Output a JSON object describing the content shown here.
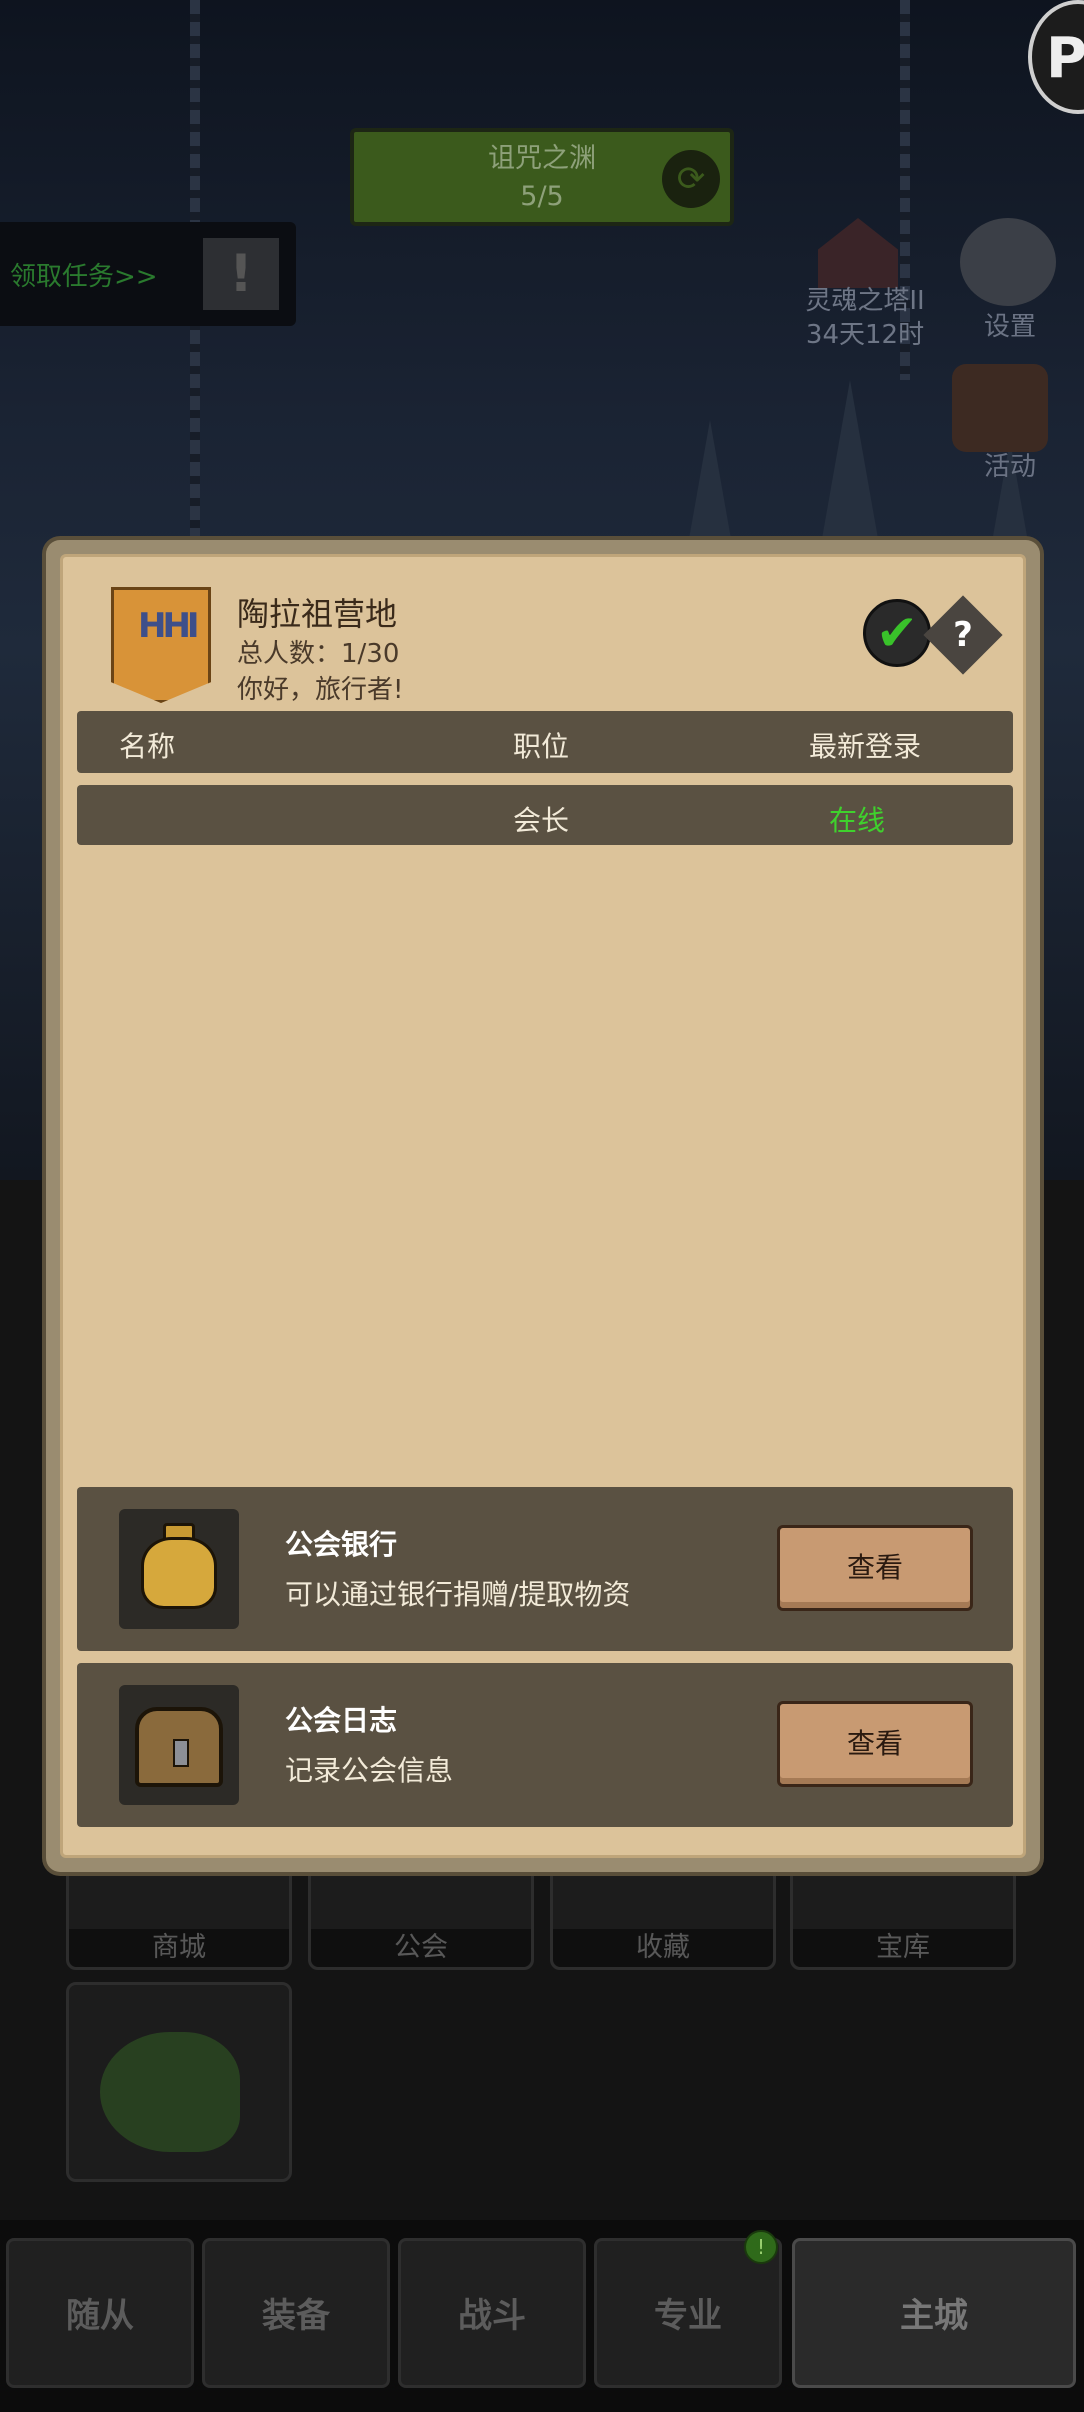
{
  "hud": {
    "curse_title": "诅咒之渊",
    "curse_count": "5/5",
    "quest_label": "领取任务>>",
    "tower_name": "灵魂之塔II",
    "tower_time": "34天12时",
    "settings_label": "设置",
    "activity_label": "活动",
    "corner_badge": "P"
  },
  "guild": {
    "name": "陶拉祖营地",
    "member_count": "总人数：1/30",
    "greeting": "你好，旅行者!",
    "banner_mark": "HHI",
    "check_glyph": "✔",
    "help_glyph": "?",
    "columns": {
      "name": "名称",
      "position": "职位",
      "last_login": "最新登录"
    },
    "members": [
      {
        "name": "",
        "position": "会长",
        "status": "在线"
      }
    ],
    "bank": {
      "title": "公会银行",
      "desc": "可以通过银行捐赠/提取物资",
      "button": "查看"
    },
    "log": {
      "title": "公会日志",
      "desc": "记录公会信息",
      "button": "查看"
    }
  },
  "menu_tiles": [
    "商城",
    "公会",
    "收藏",
    "宝库"
  ],
  "nav": [
    "随从",
    "装备",
    "战斗",
    "专业",
    "主城"
  ],
  "nav_badge": "!"
}
